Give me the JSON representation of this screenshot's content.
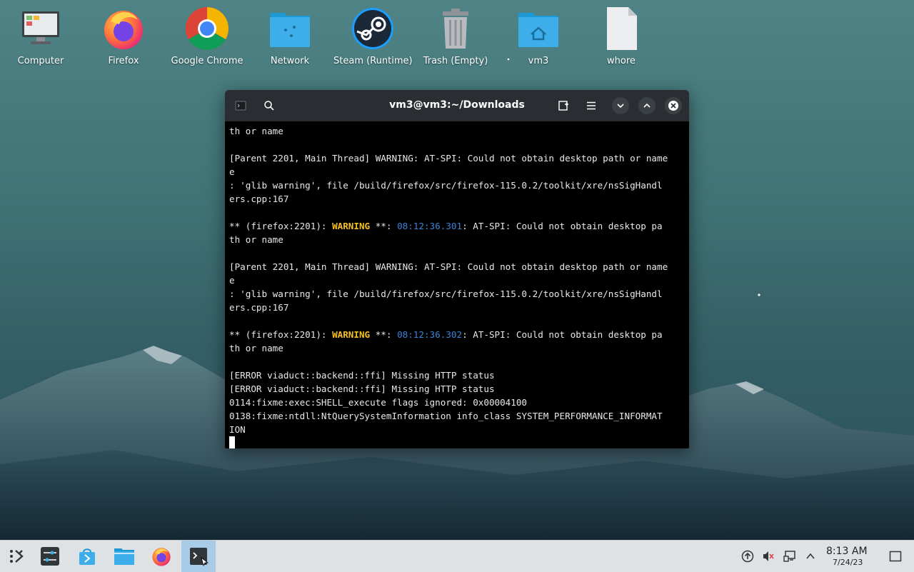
{
  "desktop": {
    "icons": [
      {
        "label": "Computer",
        "icon": "computer-icon"
      },
      {
        "label": "Firefox",
        "icon": "firefox-icon"
      },
      {
        "label": "Google Chrome",
        "icon": "chrome-icon"
      },
      {
        "label": "Network",
        "icon": "network-folder-icon"
      },
      {
        "label": "Steam (Runtime)",
        "icon": "steam-icon"
      },
      {
        "label": "Trash (Empty)",
        "icon": "trash-icon"
      },
      {
        "label": "vm3",
        "icon": "home-folder-icon"
      },
      {
        "label": "whore",
        "icon": "file-icon"
      }
    ]
  },
  "terminal": {
    "title": "vm3@vm3:~/Downloads",
    "lines": [
      "th or name",
      "",
      "[Parent 2201, Main Thread] WARNING: AT-SPI: Could not obtain desktop path or name",
      "e",
      ": 'glib warning', file /build/firefox/src/firefox-115.0.2/toolkit/xre/nsSigHandl",
      "ers.cpp:167",
      "",
      {
        "pre": "** (firefox:2201): ",
        "warn": "WARNING",
        "mid": " **: ",
        "ts": "08:12:36.301",
        "post": ": AT-SPI: Could not obtain desktop pa"
      },
      "th or name",
      "",
      "[Parent 2201, Main Thread] WARNING: AT-SPI: Could not obtain desktop path or name",
      "e",
      ": 'glib warning', file /build/firefox/src/firefox-115.0.2/toolkit/xre/nsSigHandl",
      "ers.cpp:167",
      "",
      {
        "pre": "** (firefox:2201): ",
        "warn": "WARNING",
        "mid": " **: ",
        "ts": "08:12:36.302",
        "post": ": AT-SPI: Could not obtain desktop pa"
      },
      "th or name",
      "",
      "[ERROR viaduct::backend::ffi] Missing HTTP status",
      "[ERROR viaduct::backend::ffi] Missing HTTP status",
      "0114:fixme:exec:SHELL_execute flags ignored: 0x00004100",
      "0138:fixme:ntdll:NtQuerySystemInformation info_class SYSTEM_PERFORMANCE_INFORMAT",
      "ION"
    ]
  },
  "taskbar": {
    "items": [
      "application-launcher-icon",
      "system-settings-icon",
      "discover-store-icon",
      "file-manager-icon",
      "firefox-icon",
      "terminal-icon"
    ],
    "active_item": "terminal-icon",
    "tray": [
      "updates-icon",
      "volume-muted-icon",
      "network-icon",
      "show-hidden-icon"
    ],
    "clock_time": "8:13 AM",
    "clock_date": "7/24/23"
  },
  "colors": {
    "warning": "#f4c21d",
    "timestamp": "#3b83d6",
    "titlebar": "#2a2e32",
    "taskbar": "#dfe2e5",
    "taskbar_active": "#a8cbe7"
  }
}
